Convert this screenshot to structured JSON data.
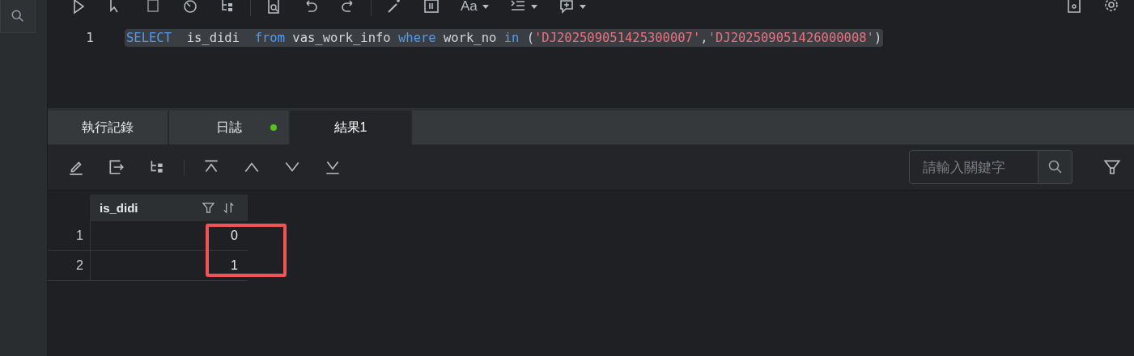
{
  "toolbar": {
    "tools": [
      {
        "kind": "play"
      },
      {
        "kind": "cursor"
      },
      {
        "kind": "stop"
      },
      {
        "kind": "timer"
      },
      {
        "kind": "tree"
      },
      {
        "kind": "doc-search"
      },
      {
        "kind": "undo"
      },
      {
        "kind": "redo"
      },
      {
        "kind": "wand"
      },
      {
        "kind": "columns"
      },
      {
        "kind": "text",
        "label": "Aa",
        "caret": true
      },
      {
        "kind": "indent",
        "caret": true
      },
      {
        "kind": "comment",
        "caret": true
      }
    ],
    "right_tools": [
      {
        "kind": "save"
      },
      {
        "kind": "settings"
      }
    ]
  },
  "editor": {
    "lines": [
      {
        "number": "1",
        "tokens": [
          {
            "kind": "keyword",
            "text": "SELECT"
          },
          {
            "kind": "plain",
            "text": "  is_didi  "
          },
          {
            "kind": "keyword",
            "text": "from"
          },
          {
            "kind": "plain",
            "text": " vas_work_info "
          },
          {
            "kind": "keyword",
            "text": "where"
          },
          {
            "kind": "plain",
            "text": " work_no "
          },
          {
            "kind": "keyword",
            "text": "in"
          },
          {
            "kind": "plain",
            "text": " ("
          },
          {
            "kind": "string",
            "text": "'DJ202509051425300007'"
          },
          {
            "kind": "plain",
            "text": ","
          },
          {
            "kind": "string",
            "text": "'DJ202509051426000008'"
          },
          {
            "kind": "plain",
            "text": ")"
          }
        ]
      }
    ]
  },
  "tabs": [
    {
      "label": "執行記錄",
      "selected": false
    },
    {
      "label": "日誌",
      "selected": false,
      "color": "#52c41a"
    },
    {
      "label": "結果1",
      "selected": true
    }
  ],
  "result_toolbar": {
    "tools": [
      {
        "kind": "edit"
      },
      {
        "kind": "export"
      },
      {
        "kind": "tree"
      },
      {
        "kind": "separator"
      },
      {
        "kind": "first"
      },
      {
        "kind": "up"
      },
      {
        "kind": "down"
      },
      {
        "kind": "last"
      }
    ],
    "search": {
      "placeholder": "請輸入關鍵字"
    }
  },
  "table": {
    "columns": [
      {
        "name": "is_didi"
      }
    ],
    "rows": [
      {
        "number": "1",
        "cells": [
          "0"
        ]
      },
      {
        "number": "2",
        "cells": [
          "1"
        ]
      }
    ]
  }
}
